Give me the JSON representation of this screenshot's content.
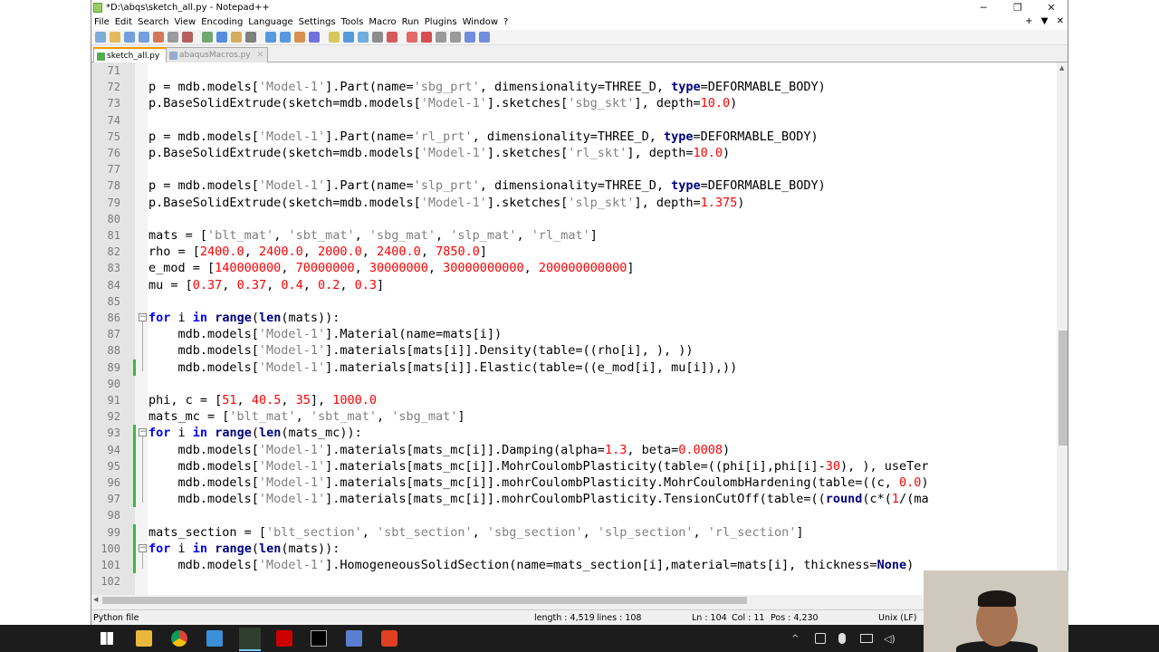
{
  "window": {
    "title": "*D:\\abqs\\sketch_all.py - Notepad++",
    "minimize": "─",
    "maximize": "❐",
    "close": "✕"
  },
  "menu": {
    "items": [
      "File",
      "Edit",
      "Search",
      "View",
      "Encoding",
      "Language",
      "Settings",
      "Tools",
      "Macro",
      "Run",
      "Plugins",
      "Window",
      "?"
    ],
    "right": [
      "+",
      "▼",
      "✕"
    ]
  },
  "tabs": [
    {
      "label": "sketch_all.py",
      "active": true
    },
    {
      "label": "abaqusMacros.py",
      "active": false
    }
  ],
  "editor": {
    "lines": [
      {
        "n": "71",
        "html": ""
      },
      {
        "n": "72",
        "html": "p = mdb.models[<span class='s'>'Model-1'</span>].Part(name=<span class='s'>'sbg_prt'</span>, dimensionality=THREE_D, <span class='o'>type</span>=DEFORMABLE_BODY)"
      },
      {
        "n": "73",
        "html": "p.BaseSolidExtrude(sketch=mdb.models[<span class='s'>'Model-1'</span>].sketches[<span class='s'>'sbg_skt'</span>], depth=<span class='n'>10.0</span>)"
      },
      {
        "n": "74",
        "html": ""
      },
      {
        "n": "75",
        "html": "p = mdb.models[<span class='s'>'Model-1'</span>].Part(name=<span class='s'>'rl_prt'</span>, dimensionality=THREE_D, <span class='o'>type</span>=DEFORMABLE_BODY)"
      },
      {
        "n": "76",
        "html": "p.BaseSolidExtrude(sketch=mdb.models[<span class='s'>'Model-1'</span>].sketches[<span class='s'>'rl_skt'</span>], depth=<span class='n'>10.0</span>)"
      },
      {
        "n": "77",
        "html": ""
      },
      {
        "n": "78",
        "html": "p = mdb.models[<span class='s'>'Model-1'</span>].Part(name=<span class='s'>'slp_prt'</span>, dimensionality=THREE_D, <span class='o'>type</span>=DEFORMABLE_BODY)"
      },
      {
        "n": "79",
        "html": "p.BaseSolidExtrude(sketch=mdb.models[<span class='s'>'Model-1'</span>].sketches[<span class='s'>'slp_skt'</span>], depth=<span class='n'>1.375</span>)"
      },
      {
        "n": "80",
        "html": ""
      },
      {
        "n": "81",
        "html": "mats = [<span class='s'>'blt_mat'</span>, <span class='s'>'sbt_mat'</span>, <span class='s'>'sbg_mat'</span>, <span class='s'>'slp_mat'</span>, <span class='s'>'rl_mat'</span>]"
      },
      {
        "n": "82",
        "html": "rho = [<span class='n'>2400.0</span>, <span class='n'>2400.0</span>, <span class='n'>2000.0</span>, <span class='n'>2400.0</span>, <span class='n'>7850.0</span>]"
      },
      {
        "n": "83",
        "html": "e_mod = [<span class='n'>140000000</span>, <span class='n'>70000000</span>, <span class='n'>30000000</span>, <span class='n'>30000000000</span>, <span class='n'>200000000000</span>]"
      },
      {
        "n": "84",
        "html": "mu = [<span class='n'>0.37</span>, <span class='n'>0.37</span>, <span class='n'>0.4</span>, <span class='n'>0.2</span>, <span class='n'>0.3</span>]"
      },
      {
        "n": "85",
        "html": ""
      },
      {
        "n": "86",
        "html": "<span class='k'>for</span> i <span class='k'>in</span> <span class='o'>range</span>(<span class='o'>len</span>(mats)):"
      },
      {
        "n": "87",
        "html": "    mdb.models[<span class='s'>'Model-1'</span>].Material(name=mats[i])"
      },
      {
        "n": "88",
        "html": "    mdb.models[<span class='s'>'Model-1'</span>].materials[mats[i]].Density(table=((rho[i], ), ))"
      },
      {
        "n": "89",
        "html": "    mdb.models[<span class='s'>'Model-1'</span>].materials[mats[i]].Elastic(table=((e_mod[i], mu[i]),))"
      },
      {
        "n": "90",
        "html": ""
      },
      {
        "n": "91",
        "html": "phi, c = [<span class='n'>51</span>, <span class='n'>40.5</span>, <span class='n'>35</span>], <span class='n'>1000.0</span>"
      },
      {
        "n": "92",
        "html": "mats_mc = [<span class='s'>'blt_mat'</span>, <span class='s'>'sbt_mat'</span>, <span class='s'>'sbg_mat'</span>]"
      },
      {
        "n": "93",
        "html": "<span class='k'>for</span> i <span class='k'>in</span> <span class='o'>range</span>(<span class='o'>len</span>(mats_mc)):"
      },
      {
        "n": "94",
        "html": "    mdb.models[<span class='s'>'Model-1'</span>].materials[mats_mc[i]].Damping(alpha=<span class='n'>1.3</span>, beta=<span class='n'>0.0008</span>)"
      },
      {
        "n": "95",
        "html": "    mdb.models[<span class='s'>'Model-1'</span>].materials[mats_mc[i]].MohrCoulombPlasticity(table=((phi[i],phi[i]-<span class='n'>30</span>), ), useTer"
      },
      {
        "n": "96",
        "html": "    mdb.models[<span class='s'>'Model-1'</span>].materials[mats_mc[i]].mohrCoulombPlasticity.MohrCoulombHardening(table=((c, <span class='n'>0.0</span>)"
      },
      {
        "n": "97",
        "html": "    mdb.models[<span class='s'>'Model-1'</span>].materials[mats_mc[i]].mohrCoulombPlasticity.TensionCutOff(table=((<span class='o'>round</span>(c*(<span class='n'>1</span>/(ma"
      },
      {
        "n": "98",
        "html": ""
      },
      {
        "n": "99",
        "html": "mats_section = [<span class='s'>'blt_section'</span>, <span class='s'>'sbt_section'</span>, <span class='s'>'sbg_section'</span>, <span class='s'>'slp_section'</span>, <span class='s'>'rl_section'</span>]"
      },
      {
        "n": "100",
        "html": "<span class='k'>for</span> i <span class='k'>in</span> <span class='o'>range</span>(<span class='o'>len</span>(mats)):"
      },
      {
        "n": "101",
        "html": "    mdb.models[<span class='s'>'Model-1'</span>].HomogeneousSolidSection(name=mats_section[i],material=mats[i], thickness=<span class='o'>None</span>)"
      },
      {
        "n": "102",
        "html": ""
      }
    ]
  },
  "status": {
    "language": "Python file",
    "length": "length : 4,519",
    "lines": "lines : 108",
    "ln": "Ln : 104",
    "col": "Col : 11",
    "pos": "Pos : 4,230",
    "eol": "Unix (LF)"
  },
  "taskbar": {
    "icons": [
      "windows-start-icon",
      "file-explorer-icon",
      "chrome-icon",
      "calculator-icon",
      "notepadpp-icon",
      "acrobat-icon",
      "terminal-icon",
      "abaqus-icon",
      "app-red-icon"
    ]
  },
  "colors": {
    "string": "#808080",
    "number": "#ff0000",
    "keyword": "#0000ff",
    "builtin": "#000080",
    "change_bar": "#3cbb3c"
  }
}
